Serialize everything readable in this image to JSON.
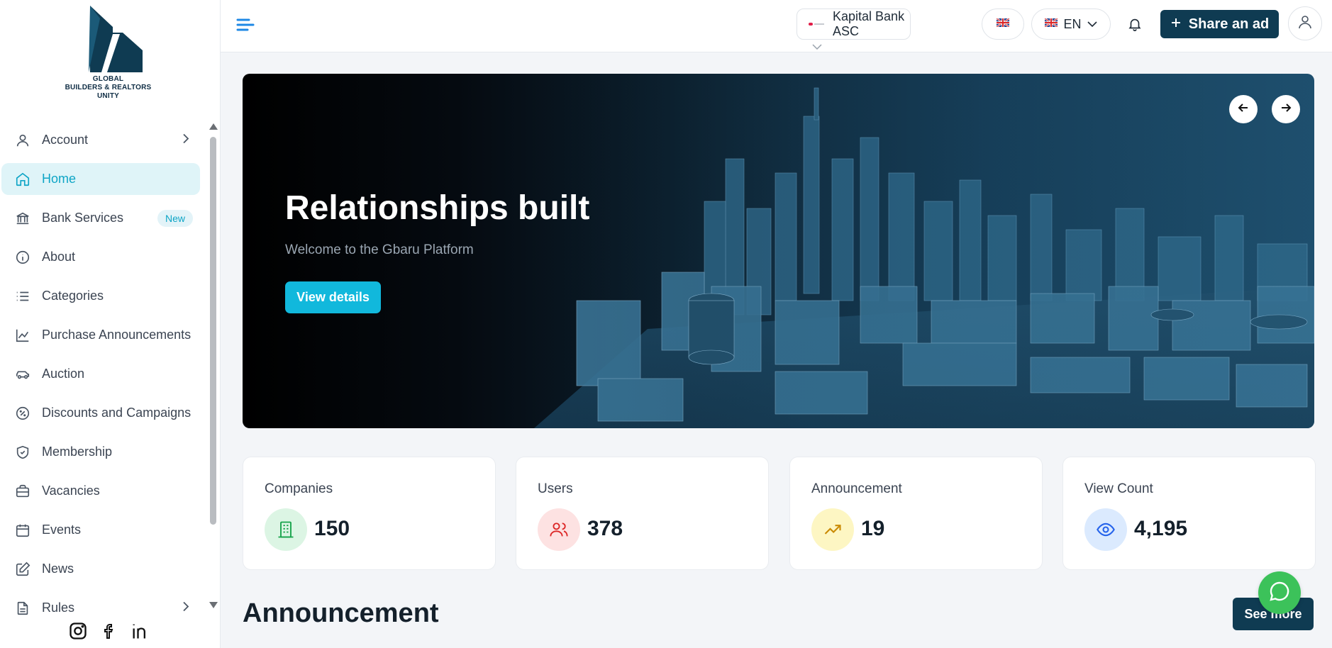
{
  "logo": {
    "line1": "GLOBAL",
    "line2": "BUILDERS & REALTORS",
    "line3": "UNITY"
  },
  "sidebar": {
    "items": [
      {
        "label": "Account",
        "icon": "user-icon",
        "has_chevron": true
      },
      {
        "label": "Home",
        "icon": "home-icon",
        "active": true
      },
      {
        "label": "Bank Services",
        "icon": "bank-icon",
        "badge": "New"
      },
      {
        "label": "About",
        "icon": "info-icon"
      },
      {
        "label": "Categories",
        "icon": "list-icon"
      },
      {
        "label": "Purchase Announcements",
        "icon": "chart-line-icon"
      },
      {
        "label": "Auction",
        "icon": "car-icon"
      },
      {
        "label": "Discounts and Campaigns",
        "icon": "discount-icon"
      },
      {
        "label": "Membership",
        "icon": "shield-check-icon"
      },
      {
        "label": "Vacancies",
        "icon": "briefcase-icon"
      },
      {
        "label": "Events",
        "icon": "calendar-icon"
      },
      {
        "label": "News",
        "icon": "edit-icon"
      },
      {
        "label": "Rules",
        "icon": "document-icon",
        "has_chevron": true
      }
    ],
    "social": [
      "instagram-icon",
      "facebook-icon",
      "linkedin-icon"
    ]
  },
  "header": {
    "bank_select": "Kapital Bank ASC",
    "language": "EN",
    "share_label": "Share an ad"
  },
  "hero": {
    "title": "Relationships built",
    "subtitle": "Welcome to the Gbaru Platform",
    "button_label": "View details"
  },
  "stats": [
    {
      "title": "Companies",
      "value": "150",
      "icon": "building-icon",
      "bg": "#dcf5e4",
      "color": "#16a34a"
    },
    {
      "title": "Users",
      "value": "378",
      "icon": "users-icon",
      "bg": "#fde2e2",
      "color": "#dc2626"
    },
    {
      "title": "Announcement",
      "value": "19",
      "icon": "trending-up-icon",
      "bg": "#fdf6c3",
      "color": "#ca8a04"
    },
    {
      "title": "View Count",
      "value": "4,195",
      "icon": "eye-icon",
      "bg": "#dbeafe",
      "color": "#2563eb"
    }
  ],
  "announcement": {
    "title": "Announcement",
    "see_more": "See more"
  },
  "colors": {
    "accent": "#11b8dc",
    "primary_dark": "#0f3b52",
    "chat_green": "#3cc25a"
  }
}
